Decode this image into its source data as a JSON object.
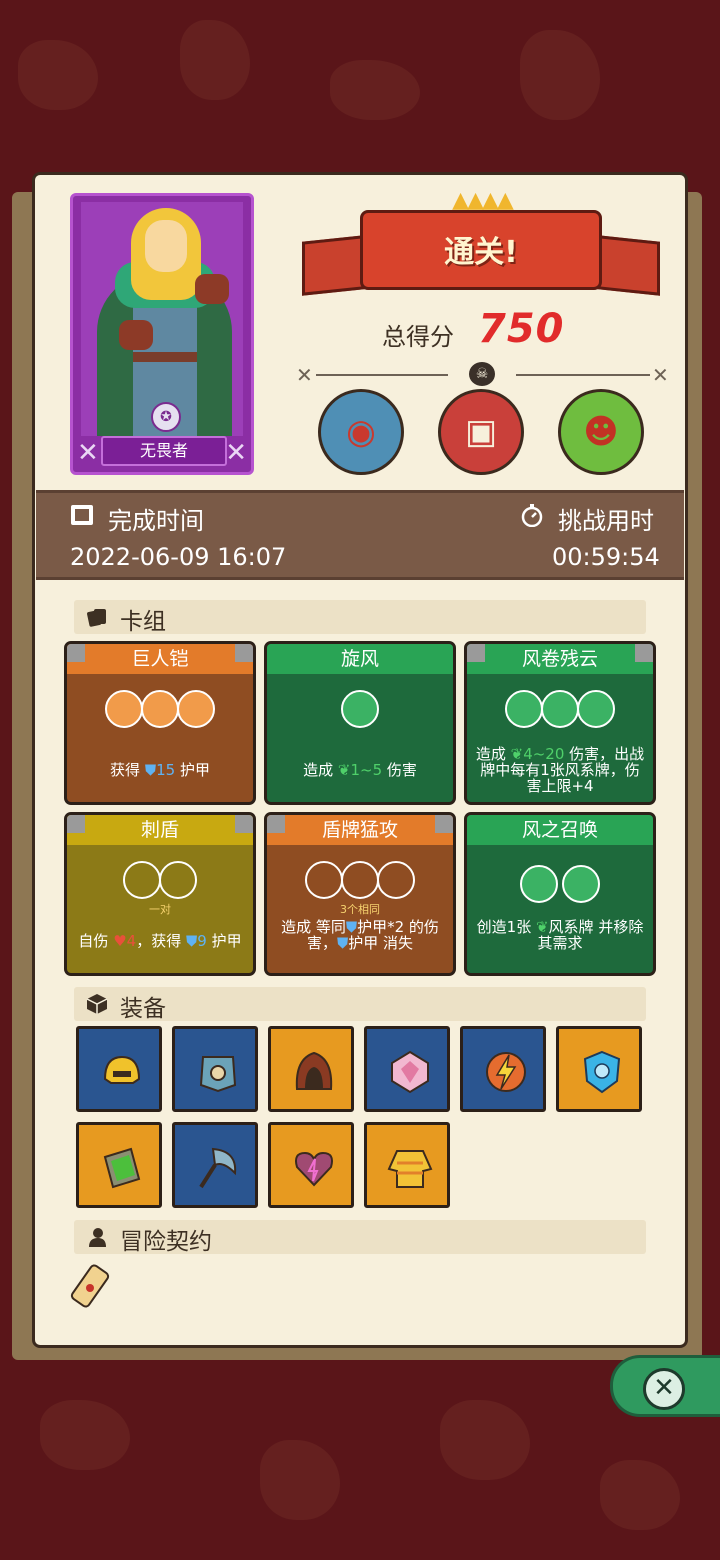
{
  "hero": {
    "name": "无畏者",
    "badge_icon": "star-emblem-icon",
    "accent": "#8b2ea4"
  },
  "result": {
    "banner": "通关!",
    "score_label": "总得分",
    "score": "750",
    "bosses": [
      "blue-fish-boss-icon",
      "red-box-boss-icon",
      "green-goblin-boss-icon"
    ]
  },
  "times": {
    "complete_label": "完成时间",
    "complete_value": "2022-06-09 16:07",
    "challenge_label": "挑战用时",
    "challenge_value": "00:59:54"
  },
  "deck": {
    "title": "卡组",
    "cards": [
      {
        "name": "巨人铠",
        "desc_pre": "获得 ",
        "desc_num": "15",
        "desc_post": " 护甲",
        "note": ""
      },
      {
        "name": "旋风",
        "desc_pre": "造成 ",
        "desc_num": "1~5",
        "desc_post": " 伤害",
        "note": ""
      },
      {
        "name": "风卷残云",
        "desc_pre": "造成 ",
        "desc_num": "4~20",
        "desc_post": " 伤害，出战牌中每有1张风系牌，伤害上限+4",
        "note": ""
      },
      {
        "name": "刺盾",
        "desc_pre": "自伤 ",
        "desc_num": "4",
        "desc_mid": "，获得 ",
        "desc_num2": "9",
        "desc_post": " 护甲",
        "note": "一对"
      },
      {
        "name": "盾牌猛攻",
        "desc_pre": "造成 等同",
        "desc_num": "",
        "desc_post": "护甲*2 的伤害，",
        "desc_post2": "护甲 消失",
        "note": "3个相同"
      },
      {
        "name": "风之召唤",
        "desc_pre": "创造1张 ",
        "desc_num": "",
        "desc_post": "风系牌 并移除其需求",
        "note": ""
      }
    ]
  },
  "equipment": {
    "title": "装备",
    "items": [
      "golden-helmet-icon",
      "chest-armor-icon",
      "hood-icon",
      "crystal-gem-icon",
      "lightning-orb-icon",
      "ice-shield-icon",
      "moss-book-icon",
      "axe-blade-icon",
      "cursed-heart-icon",
      "sweater-icon"
    ]
  },
  "contract": {
    "title": "冒险契约",
    "item": "scroll-icon"
  },
  "controls": {
    "close_icon": "close-icon"
  }
}
